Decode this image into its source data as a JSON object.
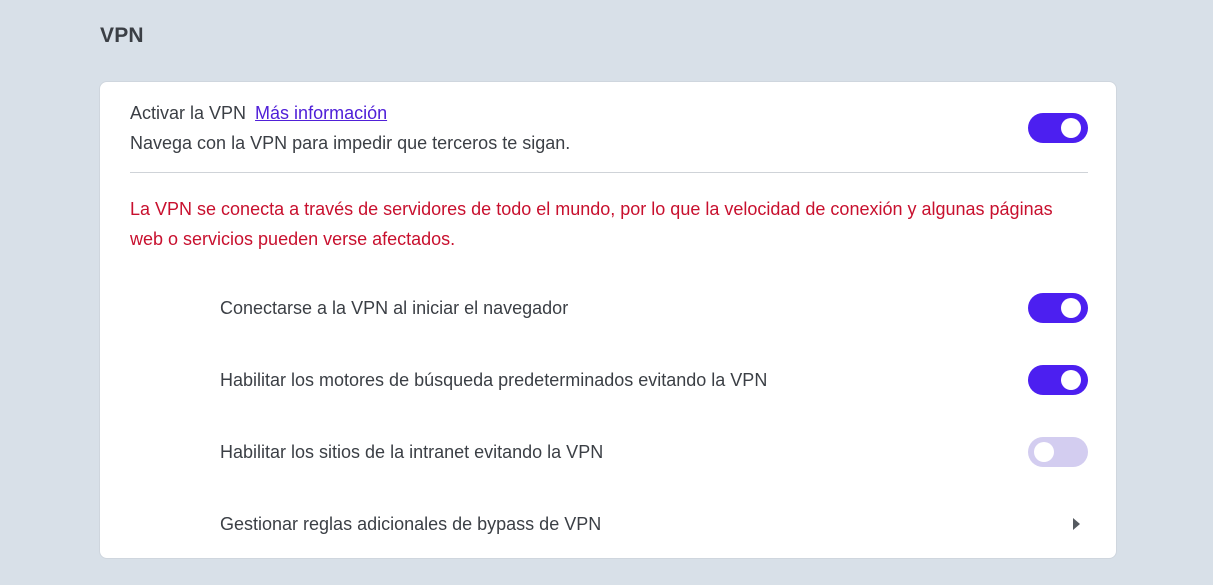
{
  "section": {
    "title": "VPN"
  },
  "main": {
    "title": "Activar la VPN",
    "link": "Más información",
    "description": "Navega con la VPN para impedir que terceros te sigan.",
    "enabled": true
  },
  "warning": "La VPN se conecta a través de servidores de todo el mundo, por lo que la velocidad de conexión y algunas páginas web o servicios pueden verse afectados.",
  "options": [
    {
      "label": "Conectarse a la VPN al iniciar el navegador",
      "enabled": true
    },
    {
      "label": "Habilitar los motores de búsqueda predeterminados evitando la VPN",
      "enabled": true
    },
    {
      "label": "Habilitar los sitios de la intranet evitando la VPN",
      "enabled": false
    }
  ],
  "bypass": {
    "label": "Gestionar reglas adicionales de bypass de VPN",
    "icon": "chevron-right-icon"
  },
  "colors": {
    "accent": "#4c1ff0",
    "toggle_off": "#d3cdf0",
    "warning": "#c8102e",
    "link": "#5020d8"
  }
}
